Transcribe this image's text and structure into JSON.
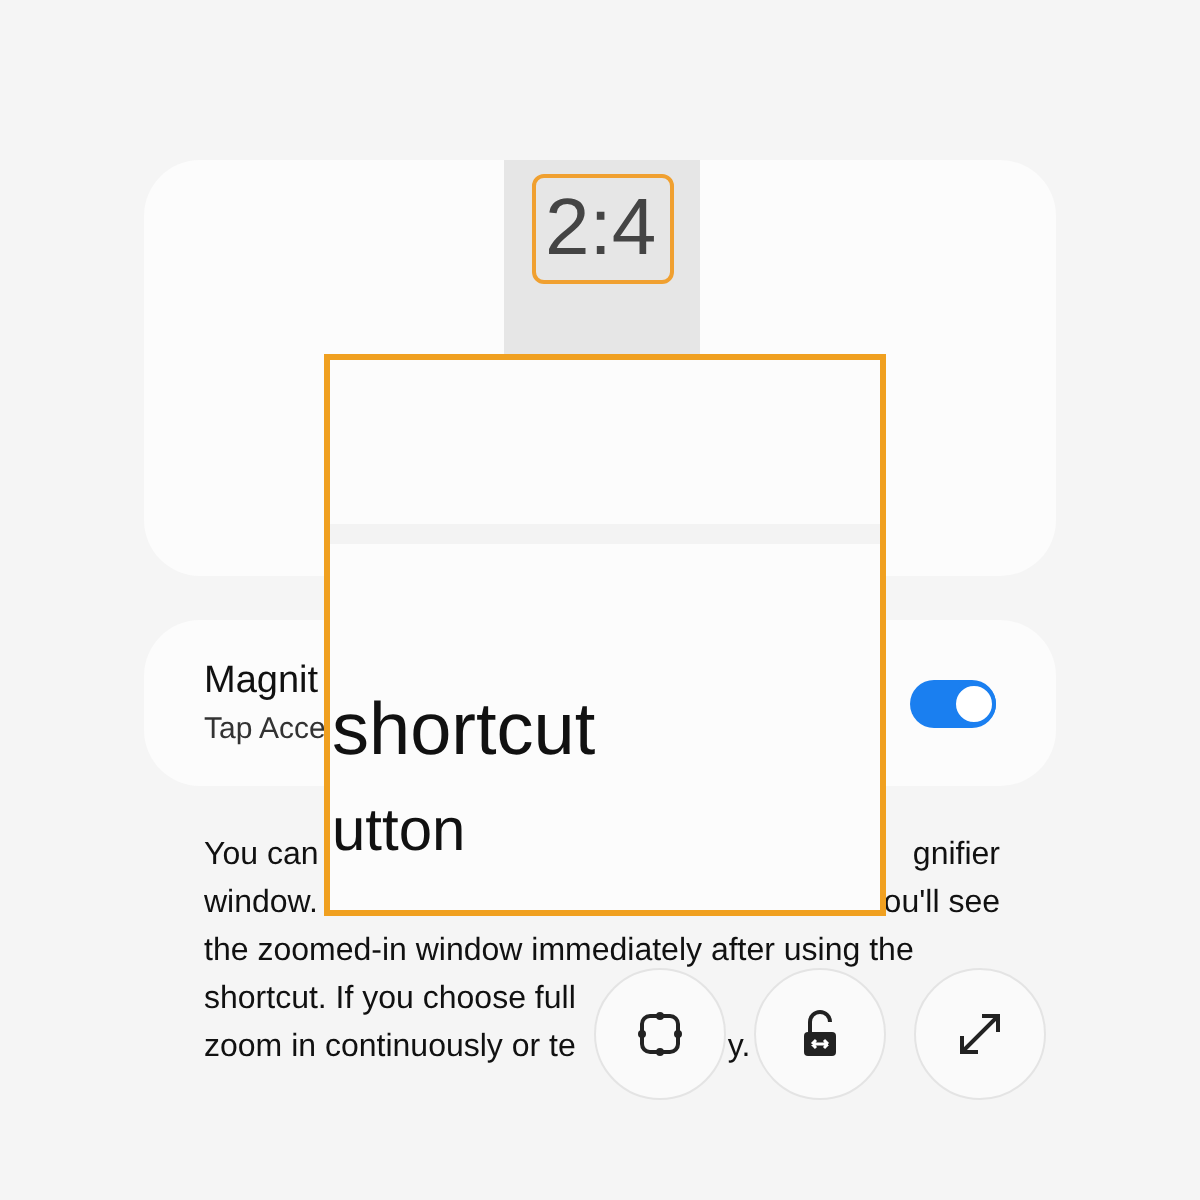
{
  "preview_card": {
    "time": "2:4"
  },
  "magnifier": {
    "lines": [
      "shortcut",
      "utton"
    ]
  },
  "setting": {
    "title": "Magnit",
    "subtitle": "Tap Acce",
    "on": true
  },
  "description": [
    {
      "kind": "split",
      "left": "You can",
      "right": "gnifier"
    },
    {
      "kind": "split",
      "left": "window.",
      "right": "ou'll see"
    },
    {
      "kind": "full",
      "left": "the zoomed-in window immediately after using the"
    },
    {
      "kind": "full",
      "left": "shortcut. If you choose full"
    },
    {
      "kind": "gap",
      "left": "zoom in continuously or te",
      "right": "y."
    }
  ],
  "controls": [
    {
      "kind": "crop"
    },
    {
      "kind": "lock"
    },
    {
      "kind": "expand"
    }
  ]
}
